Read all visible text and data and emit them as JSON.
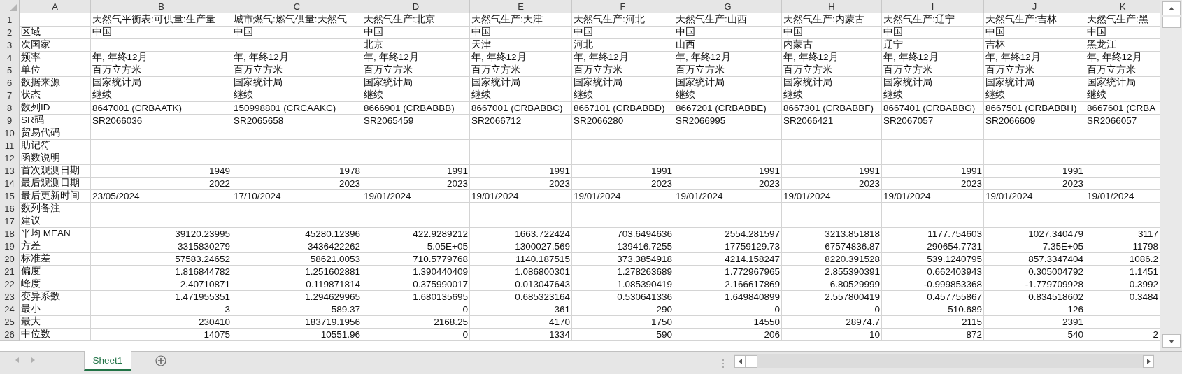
{
  "columns": [
    "A",
    "B",
    "C",
    "D",
    "E",
    "F",
    "G",
    "H",
    "I",
    "J",
    "K"
  ],
  "rows": [
    {
      "number": "1",
      "kind": "text",
      "cells": [
        null,
        "天然气平衡表:可供量:生产量",
        "城市燃气:燃气供量:天然气",
        "天然气生产:北京",
        "天然气生产:天津",
        "天然气生产:河北",
        "天然气生产:山西",
        "天然气生产:内蒙古",
        "天然气生产:辽宁",
        "天然气生产:吉林",
        "天然气生产:黑"
      ]
    },
    {
      "number": "2",
      "kind": "text",
      "cells": [
        "区域",
        "中国",
        "中国",
        "中国",
        "中国",
        "中国",
        "中国",
        "中国",
        "中国",
        "中国",
        "中国"
      ]
    },
    {
      "number": "3",
      "kind": "text",
      "cells": [
        "次国家",
        null,
        null,
        "北京",
        "天津",
        "河北",
        "山西",
        "内蒙古",
        "辽宁",
        "吉林",
        "黑龙江"
      ]
    },
    {
      "number": "4",
      "kind": "text",
      "cells": [
        "频率",
        "年, 年终12月",
        "年, 年终12月",
        "年, 年终12月",
        "年, 年终12月",
        "年, 年终12月",
        "年, 年终12月",
        "年, 年终12月",
        "年, 年终12月",
        "年, 年终12月",
        "年, 年终12月"
      ]
    },
    {
      "number": "5",
      "kind": "text",
      "cells": [
        "单位",
        "百万立方米",
        "百万立方米",
        "百万立方米",
        "百万立方米",
        "百万立方米",
        "百万立方米",
        "百万立方米",
        "百万立方米",
        "百万立方米",
        "百万立方米"
      ]
    },
    {
      "number": "6",
      "kind": "text",
      "cells": [
        "数据来源",
        "国家统计局",
        "国家统计局",
        "国家统计局",
        "国家统计局",
        "国家统计局",
        "国家统计局",
        "国家统计局",
        "国家统计局",
        "国家统计局",
        "国家统计局"
      ]
    },
    {
      "number": "7",
      "kind": "text",
      "cells": [
        "状态",
        "继续",
        "继续",
        "继续",
        "继续",
        "继续",
        "继续",
        "继续",
        "继续",
        "继续",
        "继续"
      ]
    },
    {
      "number": "8",
      "kind": "text",
      "cells": [
        "数列ID",
        "8647001 (CRBAATK)",
        "150998801 (CRCAAKC)",
        "8666901 (CRBABBB)",
        "8667001 (CRBABBC)",
        "8667101 (CRBABBD)",
        "8667201 (CRBABBE)",
        "8667301 (CRBABBF)",
        "8667401 (CRBABBG)",
        "8667501 (CRBABBH)",
        "8667601 (CRBA"
      ]
    },
    {
      "number": "9",
      "kind": "text",
      "cells": [
        "SR码",
        "SR2066036",
        "SR2065658",
        "SR2065459",
        "SR2066712",
        "SR2066280",
        "SR2066995",
        "SR2066421",
        "SR2067057",
        "SR2066609",
        "SR2066057"
      ]
    },
    {
      "number": "10",
      "kind": "text",
      "cells": [
        "贸易代码",
        null,
        null,
        null,
        null,
        null,
        null,
        null,
        null,
        null,
        null
      ]
    },
    {
      "number": "11",
      "kind": "text",
      "cells": [
        "助记符",
        null,
        null,
        null,
        null,
        null,
        null,
        null,
        null,
        null,
        null
      ]
    },
    {
      "number": "12",
      "kind": "text",
      "cells": [
        "函数说明",
        null,
        null,
        null,
        null,
        null,
        null,
        null,
        null,
        null,
        null
      ]
    },
    {
      "number": "13",
      "kind": "number",
      "cells": [
        "首次观测日期",
        "1949",
        "1978",
        "1991",
        "1991",
        "1991",
        "1991",
        "1991",
        "1991",
        "1991",
        null
      ]
    },
    {
      "number": "14",
      "kind": "number",
      "cells": [
        "最后观测日期",
        "2022",
        "2023",
        "2023",
        "2023",
        "2023",
        "2023",
        "2023",
        "2023",
        "2023",
        null
      ]
    },
    {
      "number": "15",
      "kind": "text",
      "cells": [
        "最后更新时间",
        "23/05/2024",
        "17/10/2024",
        "19/01/2024",
        "19/01/2024",
        "19/01/2024",
        "19/01/2024",
        "19/01/2024",
        "19/01/2024",
        "19/01/2024",
        "19/01/2024"
      ]
    },
    {
      "number": "16",
      "kind": "text",
      "cells": [
        "数列备注",
        null,
        null,
        null,
        null,
        null,
        null,
        null,
        null,
        null,
        null
      ]
    },
    {
      "number": "17",
      "kind": "text",
      "cells": [
        "建议",
        null,
        null,
        null,
        null,
        null,
        null,
        null,
        null,
        null,
        null
      ]
    },
    {
      "number": "18",
      "kind": "number",
      "cells": [
        "平均 MEAN",
        "39120.23995",
        "45280.12396",
        "422.9289212",
        "1663.722424",
        "703.6494636",
        "2554.281597",
        "3213.851818",
        "1177.754603",
        "1027.340479",
        "3117"
      ]
    },
    {
      "number": "19",
      "kind": "number",
      "cells": [
        "方差",
        "3315830279",
        "3436422262",
        "5.05E+05",
        "1300027.569",
        "139416.7255",
        "17759129.73",
        "67574836.87",
        "290654.7731",
        "7.35E+05",
        "11798"
      ]
    },
    {
      "number": "20",
      "kind": "number",
      "cells": [
        "标准差",
        "57583.24652",
        "58621.0053",
        "710.5779768",
        "1140.187515",
        "373.3854918",
        "4214.158247",
        "8220.391528",
        "539.1240795",
        "857.3347404",
        "1086.2"
      ]
    },
    {
      "number": "21",
      "kind": "number",
      "cells": [
        "偏度",
        "1.816844782",
        "1.251602881",
        "1.390440409",
        "1.086800301",
        "1.278263689",
        "1.772967965",
        "2.855390391",
        "0.662403943",
        "0.305004792",
        "1.1451"
      ]
    },
    {
      "number": "22",
      "kind": "number",
      "cells": [
        "峰度",
        "2.40710871",
        "0.119871814",
        "0.375990017",
        "0.013047643",
        "1.085390419",
        "2.166617869",
        "6.80529999",
        "-0.999853368",
        "-1.779709928",
        "0.3992"
      ]
    },
    {
      "number": "23",
      "kind": "number",
      "cells": [
        "变异系数",
        "1.471955351",
        "1.294629965",
        "1.680135695",
        "0.685323164",
        "0.530641336",
        "1.649840899",
        "2.557800419",
        "0.457755867",
        "0.834518602",
        "0.3484"
      ]
    },
    {
      "number": "24",
      "kind": "number",
      "cells": [
        "最小",
        "3",
        "589.37",
        "0",
        "361",
        "290",
        "0",
        "0",
        "510.689",
        "126",
        null
      ]
    },
    {
      "number": "25",
      "kind": "number",
      "cells": [
        "最大",
        "230410",
        "183719.1956",
        "2168.25",
        "4170",
        "1750",
        "14550",
        "28974.7",
        "2115",
        "2391",
        null
      ]
    },
    {
      "number": "26",
      "kind": "number",
      "cells": [
        "中位数",
        "14075",
        "10551.96",
        "0",
        "1334",
        "590",
        "206",
        "10",
        "872",
        "540",
        "2"
      ]
    }
  ],
  "sheet_tabs": [
    {
      "label": "Sheet1",
      "selected": true
    }
  ]
}
